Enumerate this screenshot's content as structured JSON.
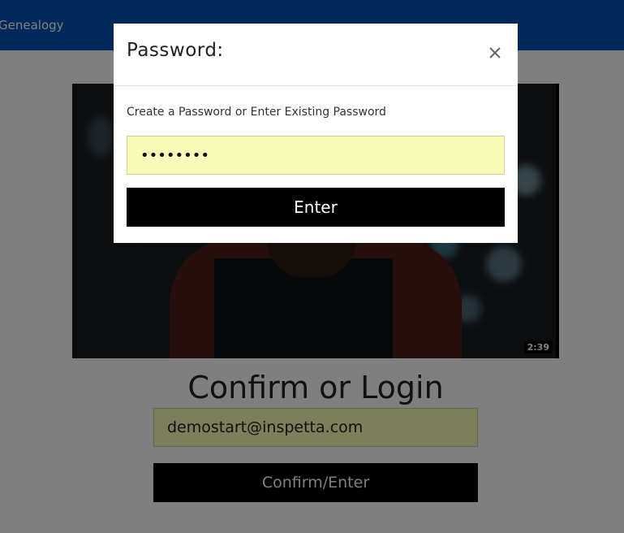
{
  "header": {
    "brand_text": "Genealogy"
  },
  "video": {
    "duration": "2:39"
  },
  "login": {
    "title": "Confirm or Login",
    "email_value": "demostart@inspetta.com",
    "confirm_label": "Confirm/Enter"
  },
  "modal": {
    "title": "Password:",
    "label": "Create a Password or Enter Existing Password",
    "password_value": "••••••••",
    "enter_label": "Enter"
  },
  "colors": {
    "header_blue": "#0052b4",
    "input_yellow": "#f8fcb8",
    "button_black": "#000000",
    "overlay": "rgba(0,0,0,0.5)"
  },
  "icons": {
    "close": "close-icon"
  }
}
